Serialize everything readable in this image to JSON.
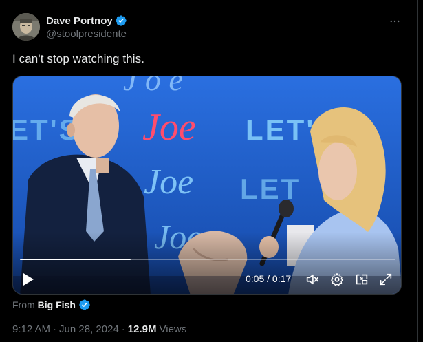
{
  "author": {
    "display_name": "Dave Portnoy",
    "handle": "@stoolpresidente",
    "verified_color": "#1d9bf0"
  },
  "menu": {
    "icon": "more-icon"
  },
  "tweet": {
    "text": "I can't stop watching this."
  },
  "video": {
    "backdrop_text_script": "Joe",
    "backdrop_text_lets": "LET'S G",
    "backdrop_text_lets_left": "ET'S",
    "time_current": "0:05",
    "time_separator": " / ",
    "time_total": "0:17",
    "progress_fraction": 0.294,
    "icons": [
      "play-icon",
      "mute-icon",
      "settings-icon",
      "pip-icon",
      "fullscreen-icon"
    ]
  },
  "source": {
    "prefix": "From",
    "name": "Big Fish"
  },
  "meta": {
    "time": "9:12 AM",
    "separator": "·",
    "date": "Jun 28, 2024",
    "views_count": "12.9M",
    "views_label": "Views"
  },
  "colors": {
    "background": "#000000",
    "text_primary": "#e7e9ea",
    "text_secondary": "#71767b",
    "accent_blue": "#1d9bf0",
    "stage_blue": "#1f5fcc"
  }
}
